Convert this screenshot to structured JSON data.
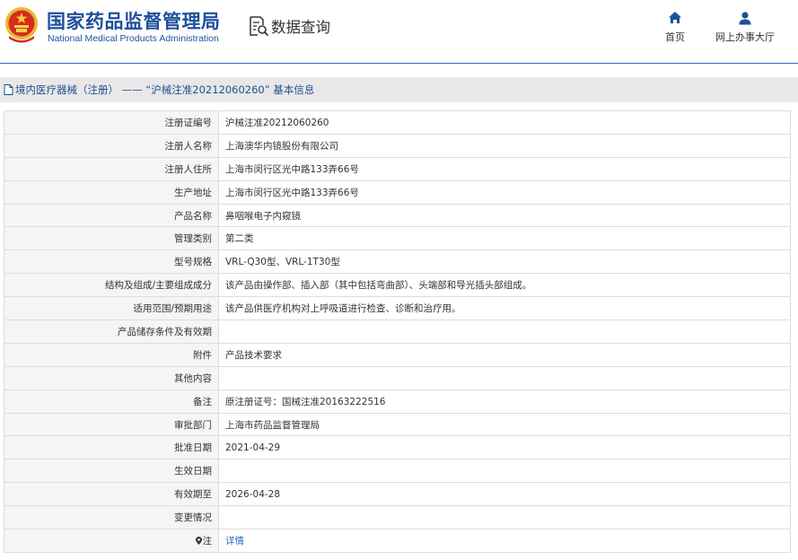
{
  "header": {
    "logo_cn": "国家药品监督管理局",
    "logo_en": "National Medical Products Administration",
    "data_query": "数据查询",
    "nav": [
      {
        "label": "首页",
        "icon": "home-icon"
      },
      {
        "label": "网上办事大厅",
        "icon": "user-icon"
      }
    ],
    "accent_color": "#1d4f9c"
  },
  "breadcrumb": "境内医疗器械（注册） —— “沪械注准20212060260” 基本信息",
  "rows": [
    {
      "label": "注册证编号",
      "value": "沪械注准20212060260"
    },
    {
      "label": "注册人名称",
      "value": "上海澳华内镜股份有限公司"
    },
    {
      "label": "注册人住所",
      "value": "上海市闵行区光中路133弄66号"
    },
    {
      "label": "生产地址",
      "value": "上海市闵行区光中路133弄66号"
    },
    {
      "label": "产品名称",
      "value": "鼻咽喉电子内窥镜"
    },
    {
      "label": "管理类别",
      "value": "第二类"
    },
    {
      "label": "型号规格",
      "value": "VRL-Q30型、VRL-1T30型"
    },
    {
      "label": "结构及组成/主要组成成分",
      "value": "该产品由操作部、插入部（其中包括弯曲部）、头端部和导光插头部组成。"
    },
    {
      "label": "适用范围/预期用途",
      "value": "该产品供医疗机构对上呼吸道进行检查、诊断和治疗用。"
    },
    {
      "label": "产品储存条件及有效期",
      "value": ""
    },
    {
      "label": "附件",
      "value": "产品技术要求"
    },
    {
      "label": "其他内容",
      "value": ""
    },
    {
      "label": "备注",
      "value": "原注册证号：国械注准20163222516"
    },
    {
      "label": "审批部门",
      "value": "上海市药品监督管理局"
    },
    {
      "label": "批准日期",
      "value": "2021-04-29"
    },
    {
      "label": "生效日期",
      "value": ""
    },
    {
      "label": "有效期至",
      "value": "2026-04-28"
    },
    {
      "label": "变更情况",
      "value": ""
    },
    {
      "label": "注",
      "value": "详情",
      "icon": "pin-icon",
      "link": true
    }
  ]
}
